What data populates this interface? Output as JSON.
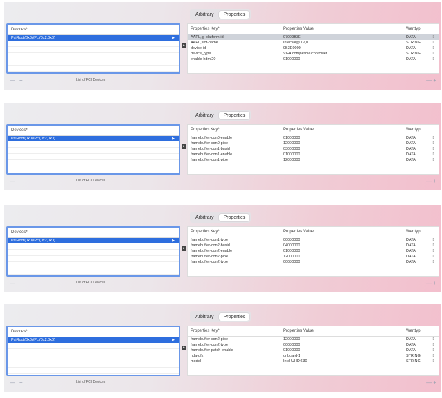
{
  "tabs": [
    "Arbitrary",
    "Properties"
  ],
  "devices_header": "Devices*",
  "caption": "List of PCI Devices",
  "controls": {
    "minus": "—",
    "plus": "+"
  },
  "props_header": {
    "key": "Properties Key*",
    "value": "Properties Value",
    "type": "Werttyp"
  },
  "panels": [
    {
      "device": "PciRoot(0x0)/Pci(0x2,0x0)",
      "rows": [
        {
          "key": "AAPL,ig-platform-id",
          "value": "07009B3E",
          "type": "DATA"
        },
        {
          "key": "AAPL,slot-name",
          "value": "Internal@0,2,0",
          "type": "STRING"
        },
        {
          "key": "device-id",
          "value": "9B3E0000",
          "type": "DATA"
        },
        {
          "key": "device_type",
          "value": "VGA compatible controller",
          "type": "STRING"
        },
        {
          "key": "enable-hdmi20",
          "value": "01000000",
          "type": "DATA"
        }
      ]
    },
    {
      "device": "PciRoot(0x0)/Pci(0x2,0x0)",
      "rows": [
        {
          "key": "framebuffer-con0-enable",
          "value": "01000000",
          "type": "DATA"
        },
        {
          "key": "framebuffer-con0-pipe",
          "value": "12000000",
          "type": "DATA"
        },
        {
          "key": "framebuffer-con1-busid",
          "value": "03000000",
          "type": "DATA"
        },
        {
          "key": "framebuffer-con1-enable",
          "value": "01000000",
          "type": "DATA"
        },
        {
          "key": "framebuffer-con1-pipe",
          "value": "12000000",
          "type": "DATA"
        }
      ]
    },
    {
      "device": "PciRoot(0x0)/Pci(0x2,0x0)",
      "rows": [
        {
          "key": "framebuffer-con1-type",
          "value": "00080000",
          "type": "DATA"
        },
        {
          "key": "framebuffer-con2-busid",
          "value": "04000000",
          "type": "DATA"
        },
        {
          "key": "framebuffer-con2-enable",
          "value": "01000000",
          "type": "DATA"
        },
        {
          "key": "framebuffer-con2-pipe",
          "value": "12000000",
          "type": "DATA"
        },
        {
          "key": "framebuffer-con2-type",
          "value": "00080000",
          "type": "DATA"
        }
      ]
    },
    {
      "device": "PciRoot(0x0)/Pci(0x2,0x0)",
      "rows": [
        {
          "key": "framebuffer-con2-pipe",
          "value": "12000000",
          "type": "DATA"
        },
        {
          "key": "framebuffer-con2-type",
          "value": "00080000",
          "type": "DATA"
        },
        {
          "key": "framebuffer-patch-enable",
          "value": "01000000",
          "type": "DATA"
        },
        {
          "key": "hda-gfx",
          "value": "onboard-1",
          "type": "STRING"
        },
        {
          "key": "model",
          "value": "Intel UHD 630",
          "type": "STRING"
        }
      ]
    }
  ]
}
